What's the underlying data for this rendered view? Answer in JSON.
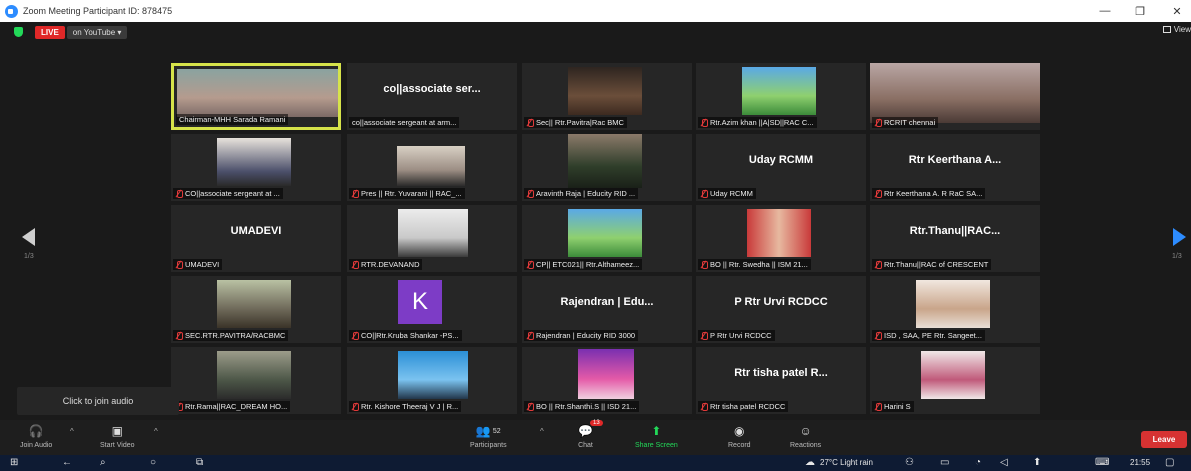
{
  "window": {
    "title": "Zoom Meeting Participant ID: 878475"
  },
  "topbar": {
    "live_label": "LIVE",
    "stream_label": "on YouTube ▾",
    "view_label": "View"
  },
  "tiles": [
    {
      "label": "Chairman-MHH Sarada Ramani",
      "big": "",
      "type": "photo",
      "active": true,
      "muted": false
    },
    {
      "label": "co||associate sergeant at arm...",
      "big": "co||associate ser...",
      "type": "text",
      "muted": false
    },
    {
      "label": "Sec|| Rtr.Pavitra|Rac BMC",
      "big": "",
      "type": "photo",
      "muted": true
    },
    {
      "label": "Rtr.Azim khan ||A|SD||RAC C...",
      "big": "",
      "type": "photo",
      "muted": true
    },
    {
      "label": "RCRIT chennai",
      "big": "",
      "type": "photo",
      "muted": true
    },
    {
      "label": "CO||associate sergeant at ...",
      "big": "",
      "type": "photo",
      "muted": true
    },
    {
      "label": "Pres || Rtr. Yuvarani || RAC_...",
      "big": "",
      "type": "photo",
      "muted": true
    },
    {
      "label": "Aravinth Raja | Educity RID ...",
      "big": "",
      "type": "photo",
      "muted": true
    },
    {
      "label": "Uday RCMM",
      "big": "Uday RCMM",
      "type": "text",
      "muted": true
    },
    {
      "label": "Rtr Keerthana A. R RaC SA...",
      "big": "Rtr Keerthana A...",
      "type": "text",
      "muted": true
    },
    {
      "label": "UMADEVI",
      "big": "UMADEVI",
      "type": "text",
      "muted": true
    },
    {
      "label": "RTR.DEVANAND",
      "big": "",
      "type": "photo",
      "muted": true
    },
    {
      "label": "CP|| ETC021|| Rtr.Althameez...",
      "big": "",
      "type": "photo",
      "muted": true
    },
    {
      "label": "BO || Rtr. Swedha || ISM 21...",
      "big": "",
      "type": "photo",
      "muted": true
    },
    {
      "label": "Rtr.Thanu||RAC of CRESCENT",
      "big": "Rtr.Thanu||RAC...",
      "type": "text",
      "muted": true
    },
    {
      "label": "SEC.RTR.PAVITRA/RACBMC",
      "big": "",
      "type": "photo",
      "muted": true
    },
    {
      "label": "CO||Rtr.Kruba Shankar -PS...",
      "big": "",
      "type": "avatar",
      "avatar": "K",
      "muted": true
    },
    {
      "label": "Rajendran | Educity RID 3000",
      "big": "Rajendran | Edu...",
      "type": "text",
      "muted": true
    },
    {
      "label": "P Rtr Urvi RCDCC",
      "big": "P Rtr Urvi RCDCC",
      "type": "text",
      "muted": true
    },
    {
      "label": "ISD , SAA, PE Rtr. Sangeet...",
      "big": "",
      "type": "photo",
      "muted": true
    },
    {
      "label": "Rtr.Rama||RAC_DREAM HO...",
      "big": "",
      "type": "photo",
      "muted": true
    },
    {
      "label": "Rtr. Kishore Theeraj V J | R...",
      "big": "",
      "type": "photo",
      "muted": true
    },
    {
      "label": "BO || Rtr.Shanthi.S || ISD 21...",
      "big": "",
      "type": "photo",
      "muted": true
    },
    {
      "label": "Rtr tisha patel RCDCC",
      "big": "Rtr tisha patel R...",
      "type": "text",
      "muted": true
    },
    {
      "label": "Harini S",
      "big": "",
      "type": "photo",
      "muted": true
    }
  ],
  "pages": {
    "left": "1/3",
    "right": "1/3"
  },
  "audio_tooltip": "Click to join audio",
  "toolbar": {
    "join_audio": "Join Audio",
    "start_video": "Start Video",
    "participants": "Participants",
    "participants_count": "52",
    "chat": "Chat",
    "chat_badge": "13",
    "share_screen": "Share Screen",
    "record": "Record",
    "reactions": "Reactions",
    "leave": "Leave"
  },
  "taskbar": {
    "weather": "27°C  Light rain",
    "time": "21:55"
  }
}
